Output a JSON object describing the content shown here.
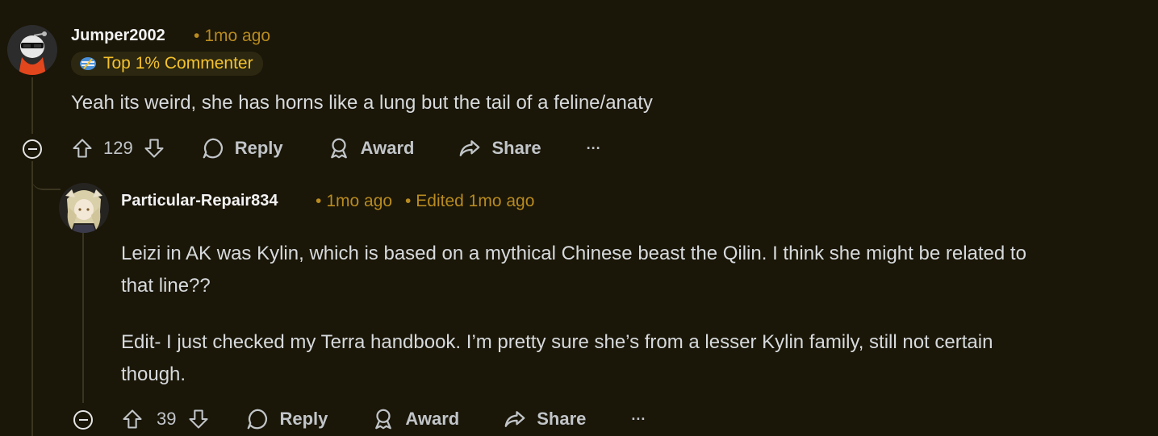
{
  "comments": [
    {
      "username": "Jumper2002",
      "time": "1mo ago",
      "flair": "Top 1% Commenter",
      "body": [
        "Yeah its weird, she has horns like a lung but the tail of a feline/anaty"
      ],
      "votes": "129",
      "actions": {
        "reply": "Reply",
        "award": "Award",
        "share": "Share",
        "more": "···"
      }
    },
    {
      "username": "Particular-Repair834",
      "time": "1mo ago",
      "edited": "Edited 1mo ago",
      "body": [
        "Leizi in AK was Kylin, which is based on a mythical Chinese beast the Qilin. I think she might be related to",
        "that line??",
        "Edit- I just checked my Terra handbook. I’m pretty sure she’s from a lesser Kylin family, still not certain",
        "though."
      ],
      "votes": "39",
      "actions": {
        "reply": "Reply",
        "award": "Award",
        "share": "Share",
        "more": "···"
      }
    }
  ],
  "colors": {
    "background": "#1a1608",
    "meta": "#b88b1f",
    "flair_text": "#f5c22c"
  }
}
